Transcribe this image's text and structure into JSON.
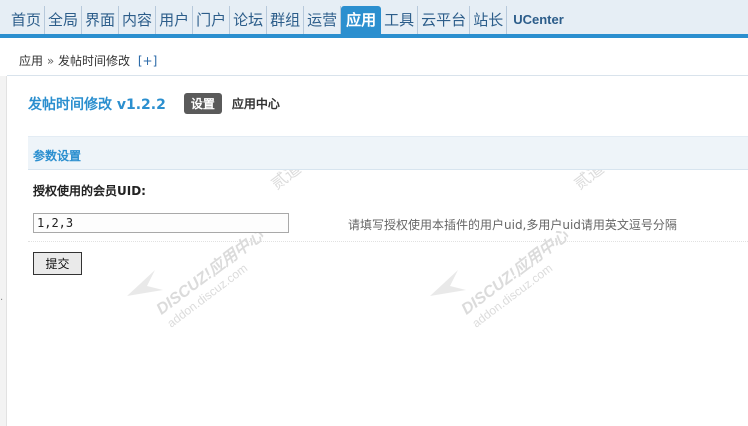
{
  "nav": {
    "items": [
      "首页",
      "全局",
      "界面",
      "内容",
      "用户",
      "门户",
      "论坛",
      "群组",
      "运营",
      "应用",
      "工具",
      "云平台",
      "站长",
      "UCenter"
    ],
    "active_index": 9
  },
  "breadcrumb": {
    "root": "应用",
    "separator": "»",
    "current": "发帖时间修改",
    "plus": "[+]"
  },
  "app": {
    "title": "发帖时间修改  v1.2.2",
    "tabs": [
      "设置",
      "应用中心"
    ]
  },
  "section": {
    "title": "参数设置"
  },
  "form": {
    "label": "授权使用的会员UID:",
    "uid_value": "1,2,3",
    "hint": "请填写授权使用本插件的用户uid,多用户uid请用英文逗号分隔",
    "submit_label": "提交"
  },
  "watermark": {
    "brand": "DISCUZ!应用中心",
    "domain": "addon.discuz.com",
    "mark": "贰道®"
  },
  "colors": {
    "accent": "#2b8fcf",
    "nav_bg": "#e6eef5",
    "section_bg": "#eef4f9"
  }
}
